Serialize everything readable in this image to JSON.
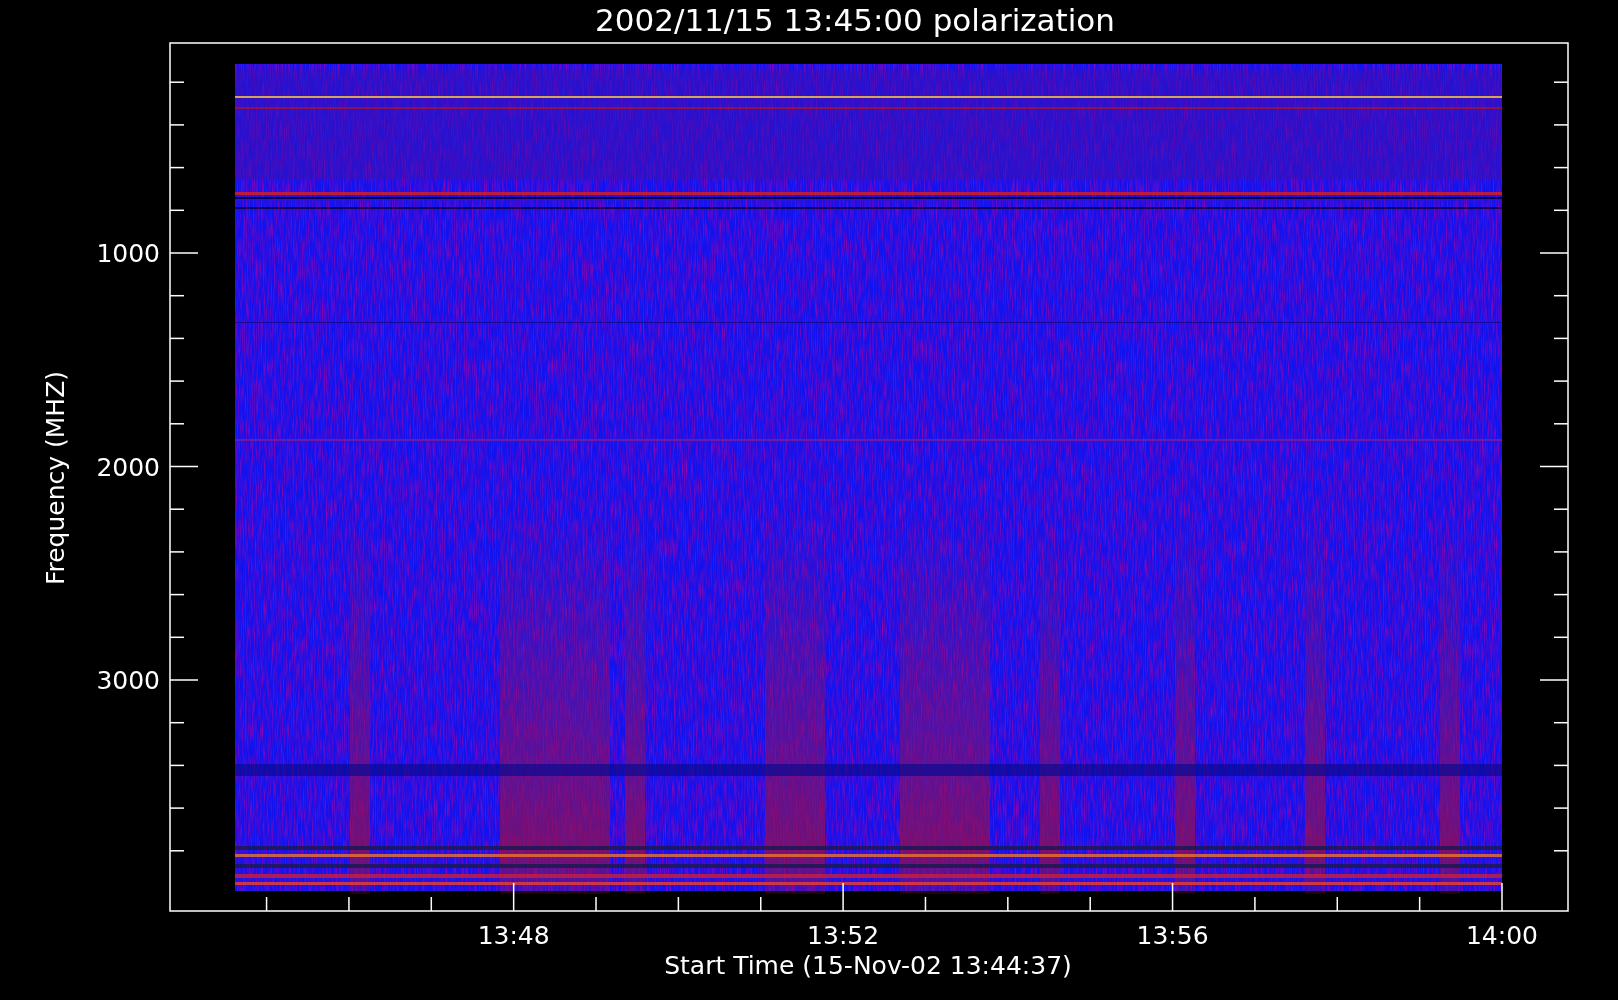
{
  "title": "2002/11/15 13:45:00 polarization",
  "y_axis": {
    "label": "Frequency (MHZ)",
    "tick_labels": [
      "1000",
      "2000",
      "3000"
    ]
  },
  "x_axis": {
    "label": "Start Time (15-Nov-02 13:44:37)",
    "tick_labels": [
      "13:48",
      "13:52",
      "13:56",
      "14:00"
    ]
  }
}
